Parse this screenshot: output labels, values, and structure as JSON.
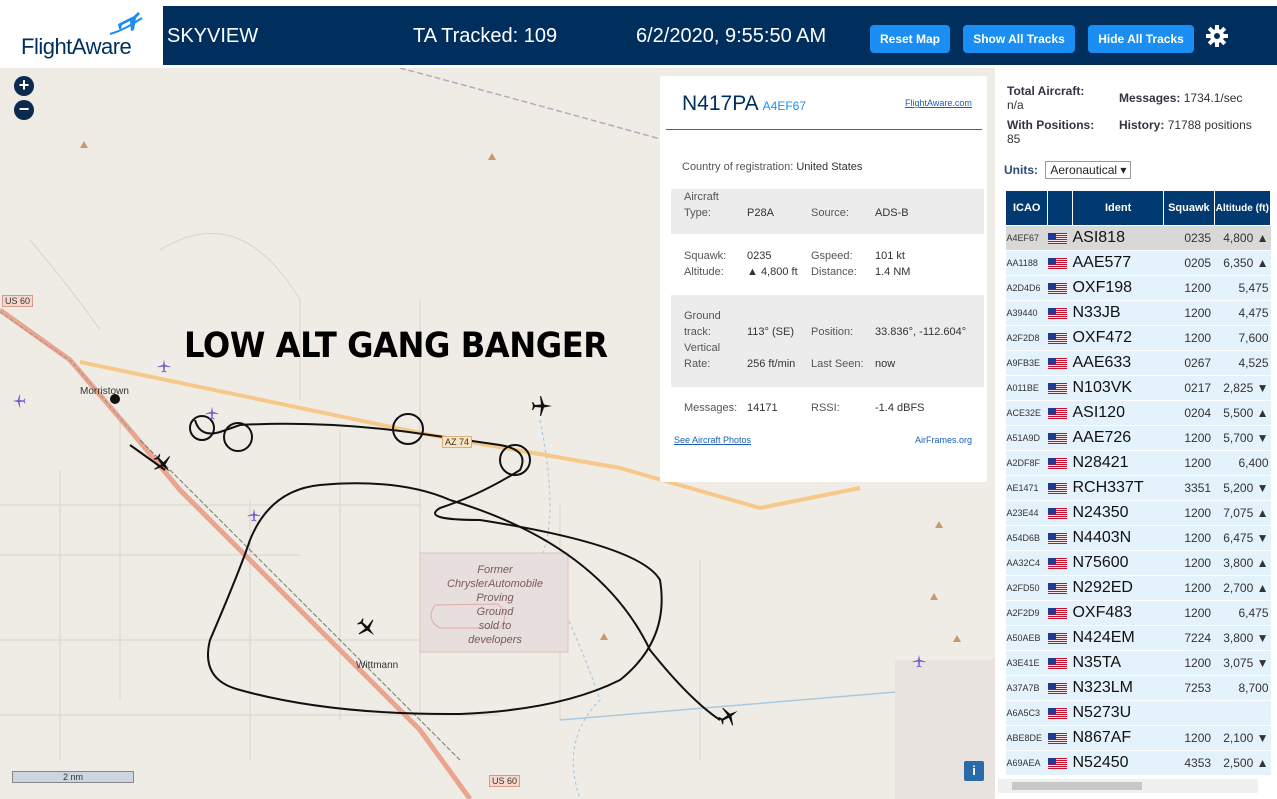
{
  "header": {
    "logo_text": "FlightAware",
    "app_name": "SKYVIEW",
    "tracked": "TA Tracked: 109",
    "datetime": "6/2/2020, 9:55:50 AM",
    "buttons": {
      "reset": "Reset Map",
      "show": "Show All Tracks",
      "hide": "Hide All Tracks"
    }
  },
  "map": {
    "zoom_in": "+",
    "zoom_out": "−",
    "overlay_text": "LOW ALT GANG BANGER",
    "labels": {
      "morristown": "Morristown",
      "wittmann": "Wittmann",
      "us60_top": "US 60",
      "us60_bottom": "US 60",
      "az74": "AZ 74",
      "proving_ground": [
        "Former",
        "ChryslerAutomobile",
        "Proving",
        "Ground",
        "sold to",
        "developers"
      ]
    },
    "scale": "2 nm",
    "info": "i"
  },
  "popup": {
    "callsign": "N417PA",
    "icao": "A4EF67",
    "link": "FlightAware.com",
    "country_label": "Country of registration:",
    "country": "United States",
    "aircraft_label": "Aircraft",
    "type_label": "Type:",
    "type": "P28A",
    "source_label": "Source:",
    "source": "ADS-B",
    "squawk_label": "Squawk:",
    "squawk": "0235",
    "gspeed_label": "Gspeed:",
    "gspeed": "101 kt",
    "altitude_label": "Altitude:",
    "altitude": "▲ 4,800 ft",
    "distance_label": "Distance:",
    "distance": "1.4 NM",
    "ground_label": "Ground",
    "track_label": "track:",
    "track": "113° (SE)",
    "position_label": "Position:",
    "position": "33.836°, -112.604°",
    "vertical_label": "Vertical",
    "rate_label": "Rate:",
    "rate": "256 ft/min",
    "lastseen_label": "Last Seen:",
    "lastseen": "now",
    "messages_label": "Messages:",
    "messages": "14171",
    "rssi_label": "RSSI:",
    "rssi": "-1.4 dBFS",
    "photos_link": "See Aircraft Photos",
    "airframes_link": "AirFrames.org"
  },
  "panel": {
    "total_label": "Total Aircraft:",
    "total": "n/a",
    "messages_label": "Messages:",
    "messages": "1734.1/sec",
    "positions_label": "With Positions:",
    "positions": "85",
    "history_label": "History:",
    "history": "71788 positions",
    "units_label": "Units:",
    "units_value": "Aeronautical ▾",
    "columns": {
      "icao": "ICAO",
      "ident": "Ident",
      "squawk": "Squawk",
      "altitude": "Altitude (ft)"
    },
    "rows": [
      {
        "icao": "A4EF67",
        "ident": "ASI818",
        "squawk": "0235",
        "alt": "4,800 ▲"
      },
      {
        "icao": "AA1188",
        "ident": "AAE577",
        "squawk": "0205",
        "alt": "6,350 ▲"
      },
      {
        "icao": "A2D4D6",
        "ident": "OXF198",
        "squawk": "1200",
        "alt": "5,475"
      },
      {
        "icao": "A39440",
        "ident": "N33JB",
        "squawk": "1200",
        "alt": "4,475"
      },
      {
        "icao": "A2F2D8",
        "ident": "OXF472",
        "squawk": "1200",
        "alt": "7,600"
      },
      {
        "icao": "A9FB3E",
        "ident": "AAE633",
        "squawk": "0267",
        "alt": "4,525"
      },
      {
        "icao": "A011BE",
        "ident": "N103VK",
        "squawk": "0217",
        "alt": "2,825 ▼"
      },
      {
        "icao": "ACE32E",
        "ident": "ASI120",
        "squawk": "0204",
        "alt": "5,500 ▲"
      },
      {
        "icao": "A51A9D",
        "ident": "AAE726",
        "squawk": "1200",
        "alt": "5,700 ▼"
      },
      {
        "icao": "A2DF8F",
        "ident": "N28421",
        "squawk": "1200",
        "alt": "6,400"
      },
      {
        "icao": "AE1471",
        "ident": "RCH337T",
        "squawk": "3351",
        "alt": "5,200 ▼"
      },
      {
        "icao": "A23E44",
        "ident": "N24350",
        "squawk": "1200",
        "alt": "7,075 ▲"
      },
      {
        "icao": "A54D6B",
        "ident": "N4403N",
        "squawk": "1200",
        "alt": "6,475 ▼"
      },
      {
        "icao": "AA32C4",
        "ident": "N75600",
        "squawk": "1200",
        "alt": "3,800 ▲"
      },
      {
        "icao": "A2FD50",
        "ident": "N292ED",
        "squawk": "1200",
        "alt": "2,700 ▲"
      },
      {
        "icao": "A2F2D9",
        "ident": "OXF483",
        "squawk": "1200",
        "alt": "6,475"
      },
      {
        "icao": "A50AEB",
        "ident": "N424EM",
        "squawk": "7224",
        "alt": "3,800 ▼"
      },
      {
        "icao": "A3E41E",
        "ident": "N35TA",
        "squawk": "1200",
        "alt": "3,075 ▼"
      },
      {
        "icao": "A37A7B",
        "ident": "N323LM",
        "squawk": "7253",
        "alt": "8,700"
      },
      {
        "icao": "A6A5C3",
        "ident": "N5273U",
        "squawk": "",
        "alt": ""
      },
      {
        "icao": "ABE8DE",
        "ident": "N867AF",
        "squawk": "1200",
        "alt": "2,100 ▼"
      },
      {
        "icao": "A69AEA",
        "ident": "N52450",
        "squawk": "4353",
        "alt": "2,500 ▲"
      }
    ]
  },
  "colors": {
    "header_bg": "#002f5d",
    "button": "#1a8ef2",
    "table_header": "#003a70",
    "row_bg": "#e4f2fb",
    "selected_row": "#d8d8d8"
  }
}
